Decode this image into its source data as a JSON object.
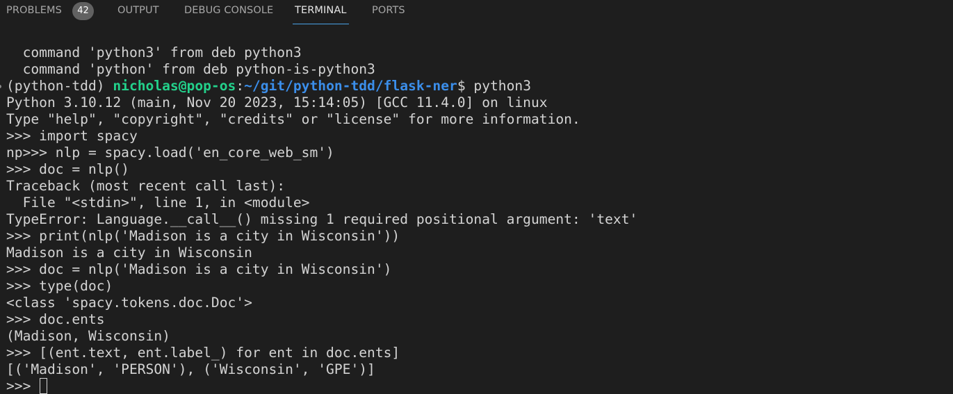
{
  "panel": {
    "tabs": [
      {
        "label": "PROBLEMS",
        "badge": "42"
      },
      {
        "label": "OUTPUT"
      },
      {
        "label": "DEBUG CONSOLE"
      },
      {
        "label": "TERMINAL",
        "active": true
      },
      {
        "label": "PORTS"
      }
    ]
  },
  "terminal": {
    "lines": [
      "  command 'python3' from deb python3",
      "  command 'python' from deb python-is-python3",
      "",
      "Python 3.10.12 (main, Nov 20 2023, 15:14:05) [GCC 11.4.0] on linux",
      "Type \"help\", \"copyright\", \"credits\" or \"license\" for more information.",
      ">>> import spacy",
      "np>>> nlp = spacy.load('en_core_web_sm')",
      ">>> doc = nlp()",
      "Traceback (most recent call last):",
      "  File \"<stdin>\", line 1, in <module>",
      "TypeError: Language.__call__() missing 1 required positional argument: 'text'",
      ">>> print(nlp('Madison is a city in Wisconsin'))",
      "Madison is a city in Wisconsin",
      ">>> doc = nlp('Madison is a city in Wisconsin')",
      ">>> type(doc)",
      "<class 'spacy.tokens.doc.Doc'>",
      ">>> doc.ents",
      "(Madison, Wisconsin)",
      ">>> [(ent.text, ent.label_) for ent in doc.ents]",
      "[('Madison', 'PERSON'), ('Wisconsin', 'GPE')]",
      ">>> "
    ],
    "prompt": {
      "env": "(python-tdd) ",
      "user_host": "nicholas@pop-os",
      "separator": ":",
      "path": "~/git/python-tdd/flask-ner",
      "suffix": "$ ",
      "command": "python3"
    }
  },
  "colors": {
    "background": "#1e1e1e",
    "text": "#d4d4d4",
    "user_host": "#23d18b",
    "path": "#3b8eea",
    "active_tab_underline": "#4aa3e8",
    "badge": "#616161"
  }
}
